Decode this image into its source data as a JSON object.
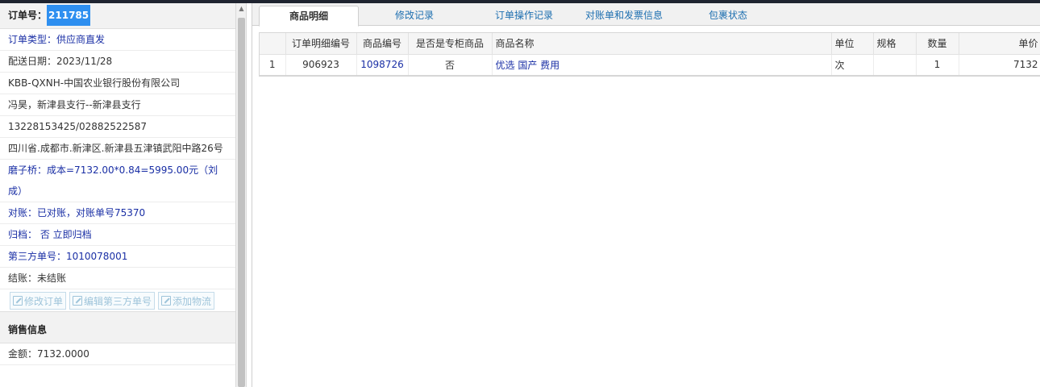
{
  "left": {
    "order_label": "订单号：",
    "order_no": "211785",
    "order_type": "订单类型：供应商直发",
    "ship_date": "配送日期：2023/11/28",
    "company": "KBB-QXNH-中国农业银行股份有限公司",
    "branch": "冯昊，新津县支行--新津县支行",
    "phone": "13228153425/02882522587",
    "address": "四川省.成都市.新津区.新津县五津镇武阳中路26号",
    "cost": "磨子桥：成本=7132.00*0.84=5995.00元（刘成）",
    "reconcile": "对账：已对账，对账单号75370",
    "archive": "归档： 否 立即归档",
    "third_party": "第三方单号：1010078001",
    "settle": "结账：未结账",
    "buttons": {
      "edit_order": "修改订单",
      "edit_third": "编辑第三方单号",
      "add_logistics": "添加物流"
    },
    "sales_header": "销售信息",
    "amount": "金额：7132.0000"
  },
  "tabs": [
    {
      "label": "商品明细"
    },
    {
      "label": "修改记录"
    },
    {
      "label": "订单操作记录"
    },
    {
      "label": "对账单和发票信息"
    },
    {
      "label": "包裹状态"
    }
  ],
  "table": {
    "headers": [
      "",
      "订单明细编号",
      "商品编号",
      "是否是专柜商品",
      "商品名称",
      "单位",
      "规格",
      "数量",
      "单价"
    ],
    "rows": [
      {
        "idx": "1",
        "detail_no": "906923",
        "product_no": "1098726",
        "counter": "否",
        "name": "优选 国产 费用",
        "unit": "次",
        "spec": "",
        "qty": "1",
        "price": "7132"
      }
    ]
  },
  "colors": {
    "accent": "#2e8ff0",
    "link": "#1a2fa5",
    "tab_text": "#1d6fb0"
  }
}
